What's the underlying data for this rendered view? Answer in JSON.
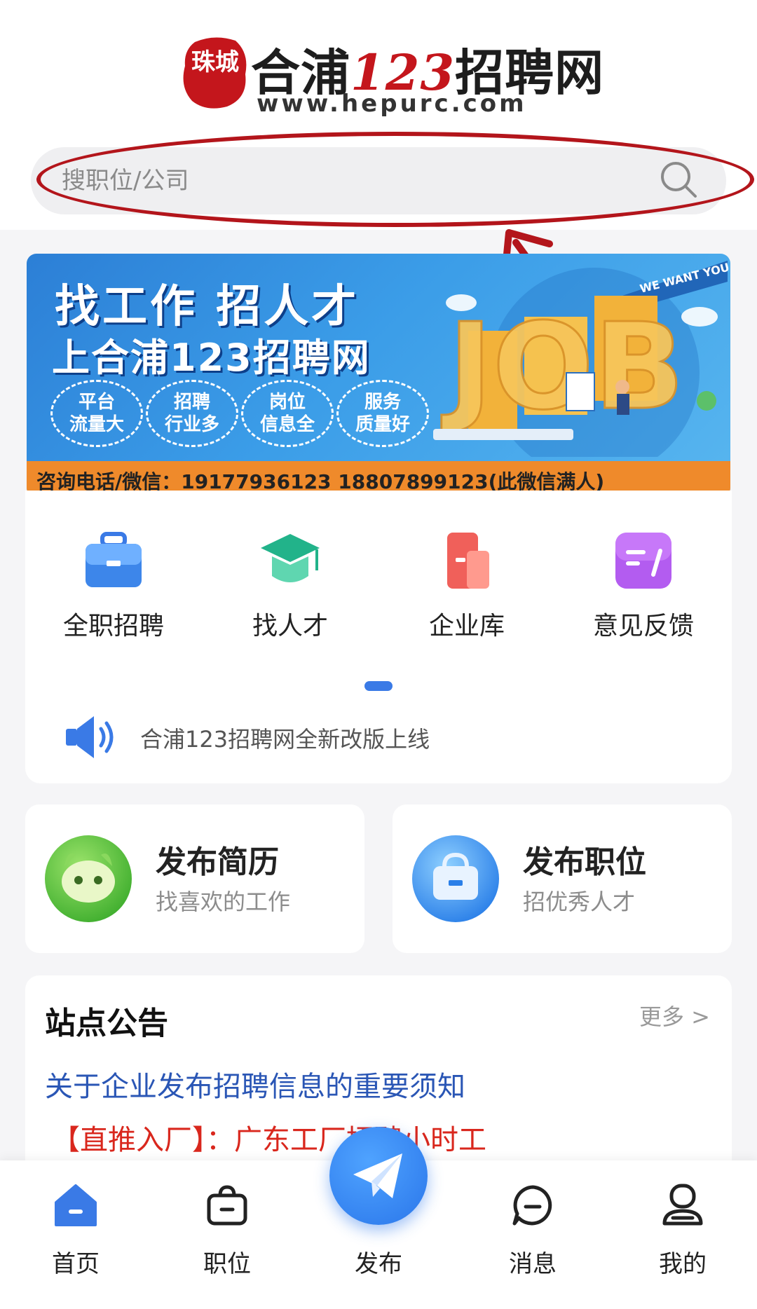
{
  "header": {
    "logo_seal_text": "珠城",
    "logo_title_prefix": "合浦",
    "logo_title_number": "123",
    "logo_title_suffix": "招聘网",
    "logo_url": "www.hepurc.com"
  },
  "search": {
    "placeholder": "搜职位/公司",
    "icon": "search-icon"
  },
  "annotation": {
    "color": "#b3151b"
  },
  "banner": {
    "headline": "找工作 招人才",
    "subline": "上合浦123招聘网",
    "features": [
      "平台\n流量大",
      "招聘\n行业多",
      "岗位\n信息全",
      "服务\n质量好"
    ],
    "contact": "咨询电话/微信：19177936123   18807899123(此微信满人)",
    "art_text": "WE WANT YOU",
    "art_word": "JOB"
  },
  "menu": {
    "items": [
      {
        "label": "全职招聘",
        "icon": "briefcase-icon"
      },
      {
        "label": "找人才",
        "icon": "graduation-cap-icon"
      },
      {
        "label": "企业库",
        "icon": "building-icon"
      },
      {
        "label": "意见反馈",
        "icon": "feedback-icon"
      }
    ],
    "notice": "合浦123招聘网全新改版上线"
  },
  "actions": [
    {
      "title": "发布简历",
      "subtitle": "找喜欢的工作",
      "icon": "mascot-icon"
    },
    {
      "title": "发布职位",
      "subtitle": "招优秀人才",
      "icon": "bag-icon"
    }
  ],
  "announcement": {
    "title": "站点公告",
    "more": "更多 >",
    "items": [
      "关于企业发布招聘信息的重要须知",
      "【直推入厂】：广东工厂招聘小时工"
    ]
  },
  "nav": {
    "items": [
      {
        "label": "首页",
        "icon": "home-icon"
      },
      {
        "label": "职位",
        "icon": "job-bag-icon"
      },
      {
        "label": "发布",
        "icon": "paper-plane-icon"
      },
      {
        "label": "消息",
        "icon": "message-icon"
      },
      {
        "label": "我的",
        "icon": "user-icon"
      }
    ]
  },
  "colors": {
    "accent": "#3a7ae6",
    "brand_red": "#c4161c",
    "link_blue": "#2a56b5",
    "highlight_red": "#d9271d"
  }
}
